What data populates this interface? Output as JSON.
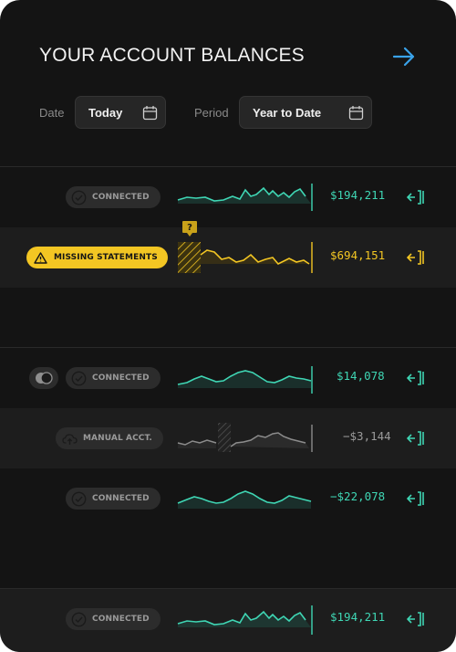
{
  "header": {
    "title": "YOUR ACCOUNT BALANCES",
    "arrow_icon": "arrow-right-icon",
    "accent": "#3aa3ea"
  },
  "filters": {
    "date": {
      "label": "Date",
      "value": "Today"
    },
    "period": {
      "label": "Period",
      "value": "Year to Date"
    }
  },
  "colors": {
    "positive": "#3fd6b4",
    "warning": "#f3c623",
    "muted": "#9b9b9b"
  },
  "accounts": [
    {
      "status": "CONNECTED",
      "status_icon": "check-circle-icon",
      "amount": "$194,211",
      "action_icon": "sync-arrow-icon"
    },
    {
      "status": "MISSING STATEMENTS",
      "status_icon": "warning-triangle-icon",
      "badge": "?",
      "amount": "$694,151",
      "action_icon": "sync-arrow-icon"
    },
    {
      "status": "CONNECTED",
      "status_icon": "check-circle-icon",
      "toggle_icon": "toggle-icon",
      "amount": "$14,078",
      "action_icon": "sync-arrow-icon"
    },
    {
      "status": "MANUAL ACCT.",
      "status_icon": "cloud-upload-icon",
      "amount": "−$3,144",
      "action_icon": "sync-arrow-icon"
    },
    {
      "status": "CONNECTED",
      "status_icon": "check-circle-icon",
      "amount": "−$22,078",
      "action_icon": "sync-arrow-icon"
    },
    {
      "status": "CONNECTED",
      "status_icon": "check-circle-icon",
      "amount": "$194,211",
      "action_icon": "sync-arrow-icon"
    }
  ]
}
